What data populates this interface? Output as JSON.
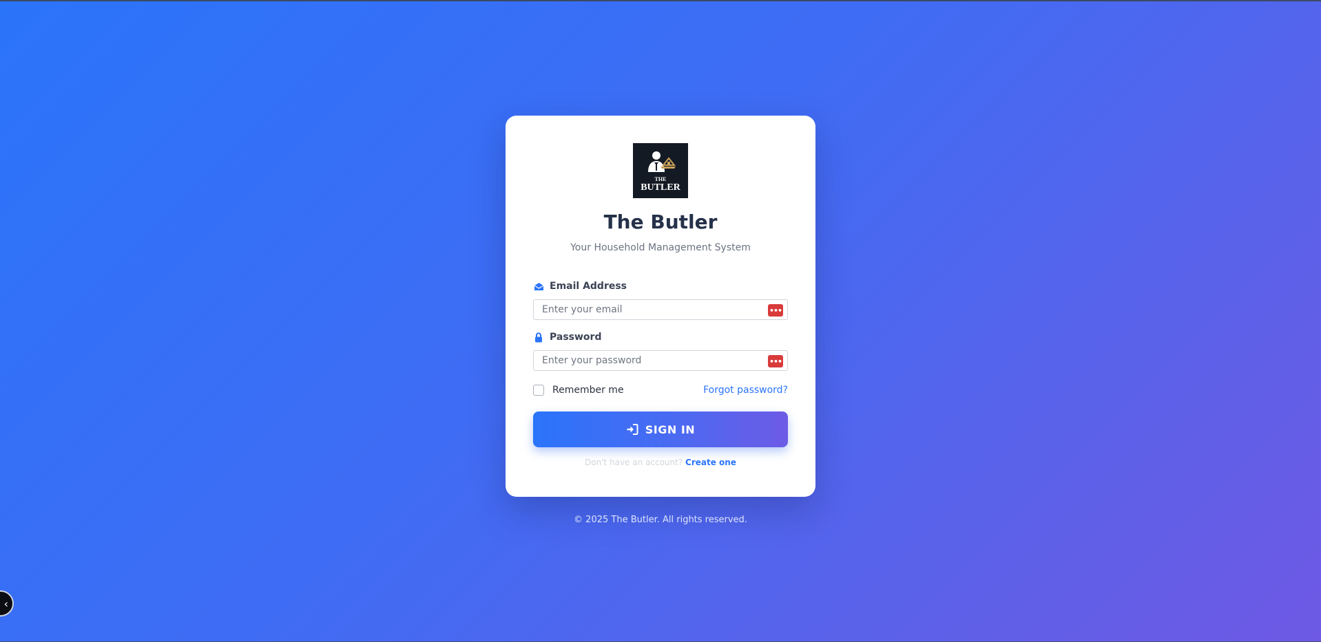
{
  "brand": {
    "logo_alt": "THE BUTLER",
    "logo_small": "THE",
    "logo_big": "BUTLER",
    "title": "The Butler",
    "subtitle": "Your Household Management System"
  },
  "form": {
    "email_label": "Email Address",
    "email_placeholder": "Enter your email",
    "email_value": "",
    "password_label": "Password",
    "password_placeholder": "Enter your password",
    "password_value": "",
    "remember_label": "Remember me",
    "remember_checked": false,
    "forgot_label": "Forgot password?",
    "submit_label": "SIGN IN",
    "no_account_text": "Don't have an account?",
    "create_label": "Create one"
  },
  "footer": {
    "copyright": "© 2025 The Butler. All rights reserved."
  },
  "icons": {
    "email": "envelope-icon",
    "password": "lock-icon",
    "submit": "sign-in-icon",
    "password_manager": "password-manager-icon",
    "floating": "chevron-left-icon"
  },
  "colors": {
    "accent": "#2a74fa",
    "gradient_end": "#6e59e4",
    "title": "#26314a",
    "password_manager_badge": "#d93a3a"
  }
}
